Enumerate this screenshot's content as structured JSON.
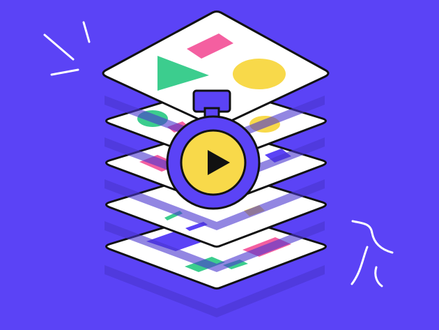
{
  "scene": {
    "description_icon": "stacked-layers-with-play-timer-icon",
    "colors": {
      "background": "#5b43f6",
      "card": "#ffffff",
      "card_shadow": "#4a36cf",
      "outline": "#111111",
      "pink": "#f45fa0",
      "green": "#3ccd8e",
      "yellow": "#f8d94a",
      "purple_shape": "#5b43f6",
      "timer_body": "#5b43f6",
      "timer_face": "#f8d94a",
      "play_triangle": "#111111",
      "spark_lines": "#ffffff",
      "faint_shape": "#d9d9e0"
    },
    "layers": [
      {
        "name": "bottom-layer"
      },
      {
        "name": "layer-4"
      },
      {
        "name": "layer-3"
      },
      {
        "name": "layer-2"
      },
      {
        "name": "top-layer"
      }
    ],
    "icons": {
      "timer": "stopwatch-icon",
      "play": "play-icon",
      "sparks_left": "spark-lines-icon",
      "sparks_right": "burst-lines-icon"
    }
  }
}
